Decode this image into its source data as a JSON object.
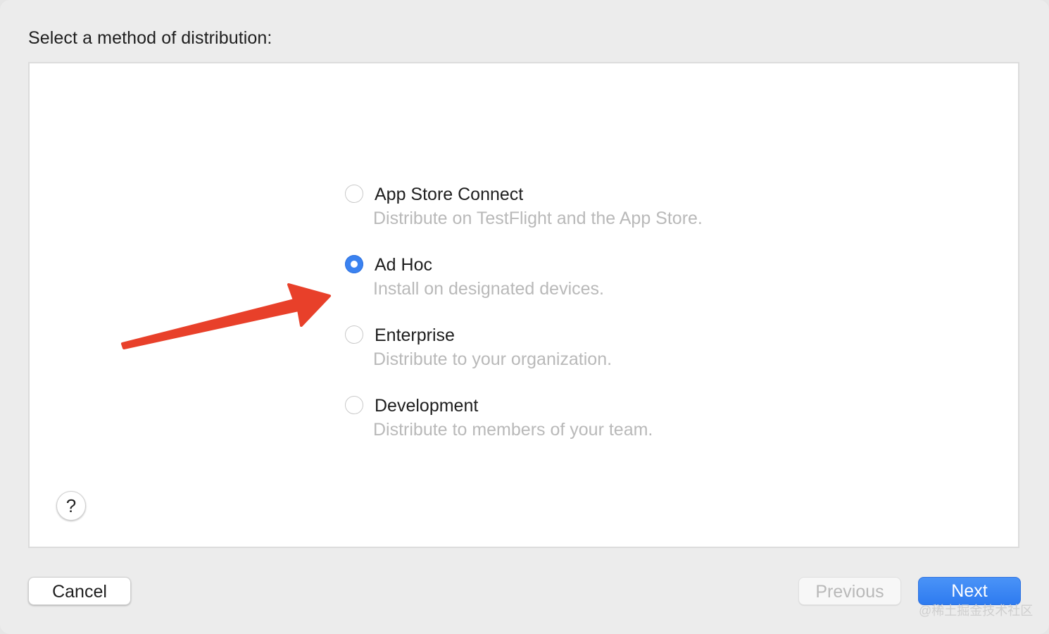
{
  "dialog": {
    "heading": "Select a method of distribution:"
  },
  "options": [
    {
      "title": "App Store Connect",
      "description": "Distribute on TestFlight and the App Store.",
      "selected": false
    },
    {
      "title": "Ad Hoc",
      "description": "Install on designated devices.",
      "selected": true
    },
    {
      "title": "Enterprise",
      "description": "Distribute to your organization.",
      "selected": false
    },
    {
      "title": "Development",
      "description": "Distribute to members of your team.",
      "selected": false
    }
  ],
  "help": {
    "label": "?"
  },
  "buttons": {
    "cancel": "Cancel",
    "previous": "Previous",
    "next": "Next"
  },
  "annotation": {
    "arrow_color": "#e8402a"
  },
  "watermark": "@稀土掘金技术社区",
  "colors": {
    "accent": "#3b82f0",
    "disabled_text": "#b9b9b9"
  }
}
